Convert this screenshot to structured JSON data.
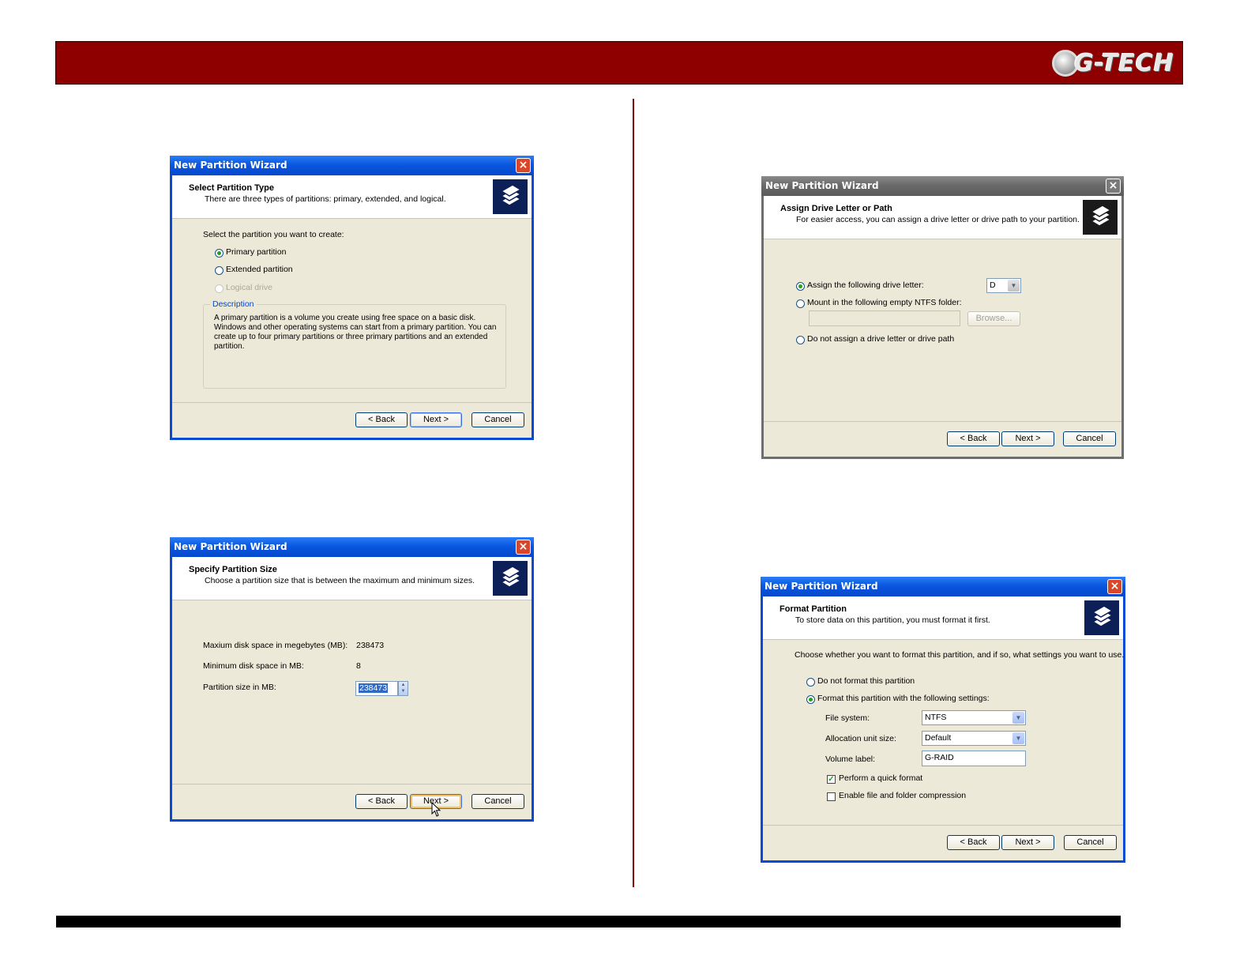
{
  "brand": {
    "logo_text": "G-TECH"
  },
  "wizard1": {
    "title": "New Partition Wizard",
    "close": "×",
    "header_title": "Select Partition Type",
    "header_subtitle": "There are three types of partitions: primary, extended, and logical.",
    "prompt": "Select the partition you want to create:",
    "options": [
      "Primary partition",
      "Extended partition",
      "Logical drive"
    ],
    "selected_option": "Primary partition",
    "description_title": "Description",
    "description_text": "A primary partition is a volume you create using free space on a basic disk. Windows and other operating systems can start from a primary partition. You can create up to four primary partitions or three primary partitions and an extended partition.",
    "back": "< Back",
    "next": "Next >",
    "cancel": "Cancel"
  },
  "wizard2": {
    "title": "New Partition Wizard",
    "close": "×",
    "header_title": "Specify Partition Size",
    "header_subtitle": "Choose a partition size that is between the maximum and minimum sizes.",
    "max_label": "Maxium disk space in megebytes (MB):",
    "max_value": "238473",
    "min_label": "Minimum disk space in MB:",
    "min_value": "8",
    "size_label": "Partition size in MB:",
    "size_value": "238473",
    "back": "< Back",
    "next": "Next >",
    "cancel": "Cancel"
  },
  "wizard3": {
    "title": "New Partition Wizard",
    "close": "×",
    "header_title": "Assign Drive Letter or Path",
    "header_subtitle": "For easier access, you can assign a drive letter or drive path to your partition.",
    "opt_letter": "Assign the following drive letter:",
    "drive_letter": "D",
    "opt_folder": "Mount in the following empty NTFS folder:",
    "folder_value": "",
    "browse": "Browse...",
    "opt_none": "Do not assign a drive letter or drive path",
    "back": "< Back",
    "next": "Next >",
    "cancel": "Cancel"
  },
  "wizard4": {
    "title": "New Partition Wizard",
    "close": "×",
    "header_title": "Format Partition",
    "header_subtitle": "To store data on this partition, you must format it first.",
    "prompt": "Choose whether you want to format this partition, and if so, what settings you want to use.",
    "opt_no_format": "Do not format this partition",
    "opt_format": "Format this partition with the following settings:",
    "fs_label": "File system:",
    "fs_value": "NTFS",
    "alloc_label": "Allocation unit size:",
    "alloc_value": "Default",
    "volume_label": "Volume label:",
    "volume_value": "G-RAID",
    "quick_format": "Perform a quick format",
    "quick_format_checked": true,
    "compression": "Enable file and folder compression",
    "compression_checked": false,
    "back": "< Back",
    "next": "Next >",
    "cancel": "Cancel"
  },
  "colors": {
    "header_band": "#8e0000",
    "divider": "#8e0000",
    "footer_band": "#000000",
    "xp_blue": "#0a4bd6"
  }
}
